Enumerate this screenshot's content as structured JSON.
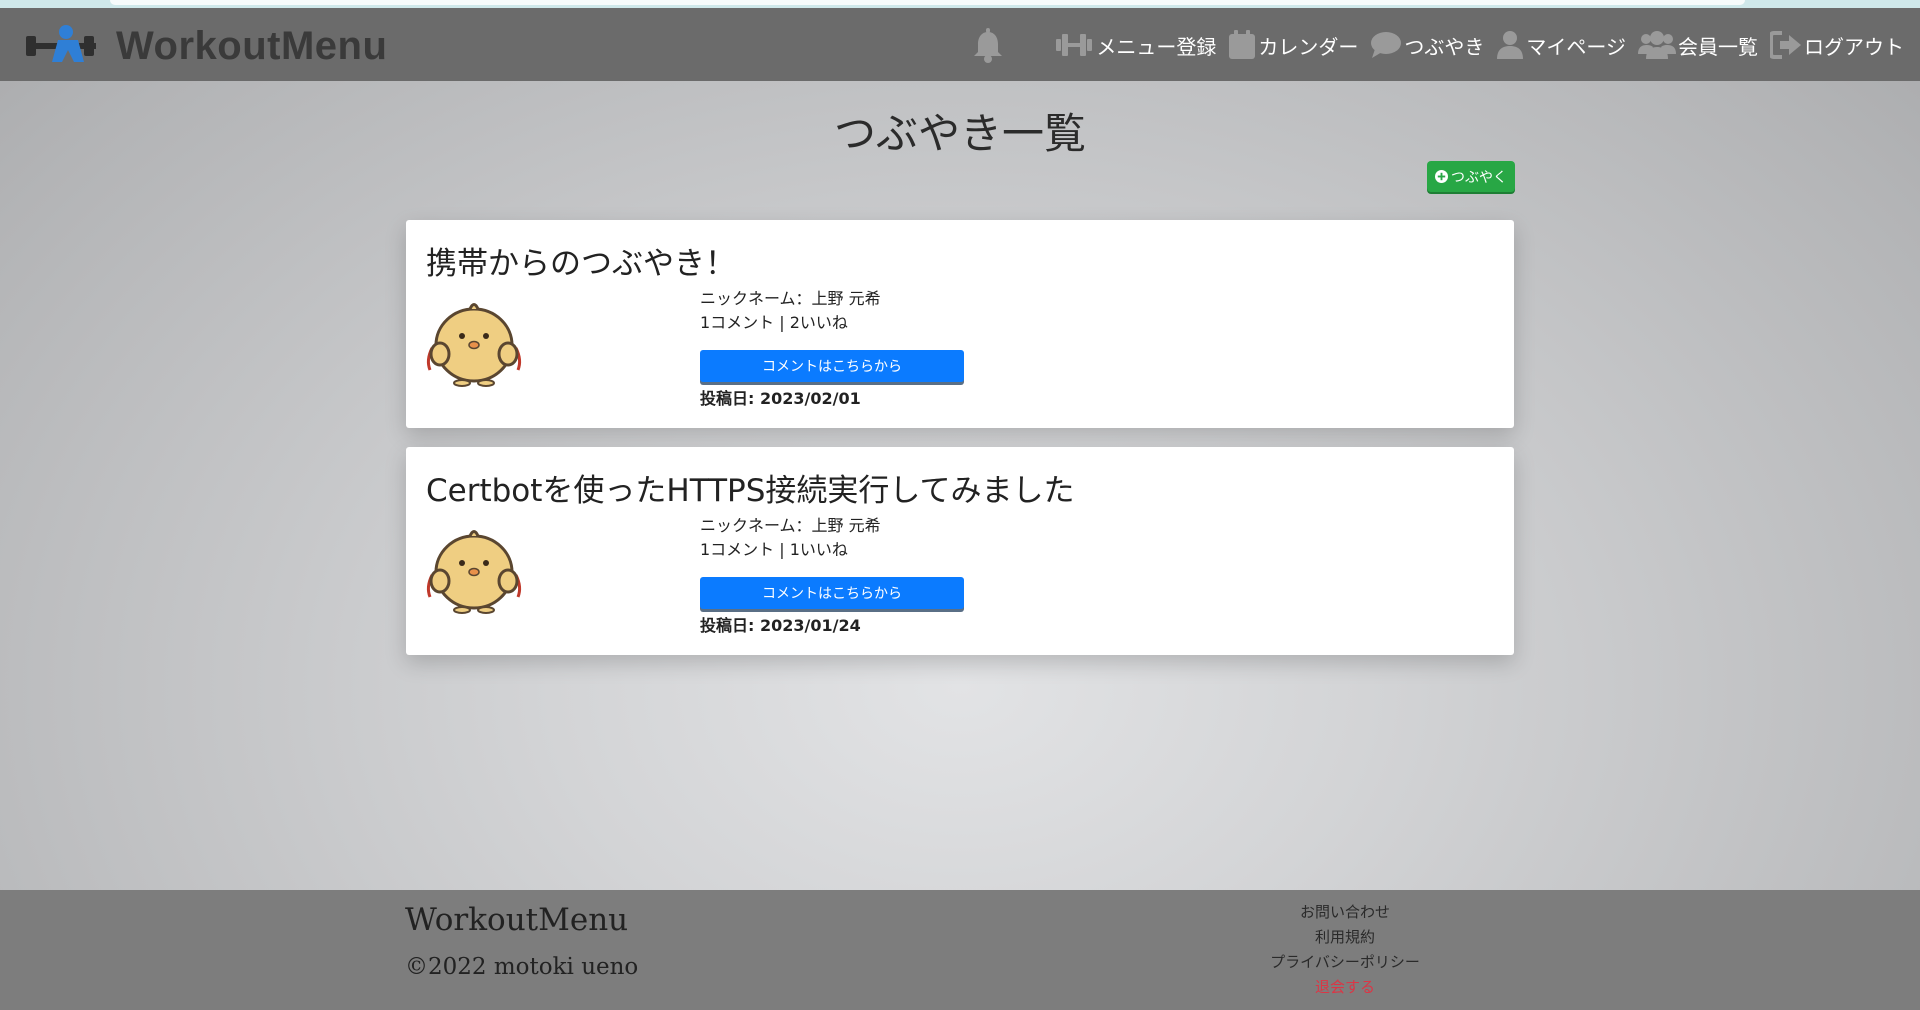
{
  "navbar": {
    "brand": "WorkoutMenu",
    "items": [
      {
        "label": "メニュー登録",
        "icon": "dumbbell-icon"
      },
      {
        "label": "カレンダー",
        "icon": "calendar-icon"
      },
      {
        "label": "つぶやき",
        "icon": "speech-bubble-icon"
      },
      {
        "label": "マイページ",
        "icon": "user-icon"
      },
      {
        "label": "会員一覧",
        "icon": "users-icon"
      },
      {
        "label": "ログアウト",
        "icon": "logout-icon"
      }
    ],
    "notification_icon": "bell-icon"
  },
  "page": {
    "title": "つぶやき一覧",
    "new_post_label": "つぶやく"
  },
  "posts": [
    {
      "title": "携帯からのつぶやき！",
      "nickname": "ニックネーム：上野 元希",
      "stats": "1コメント | 2いいね",
      "comment_button": "コメントはこちらから",
      "date": "投稿日: 2023/02/01"
    },
    {
      "title": "Certbotを使ったHTTPS接続実行してみました",
      "nickname": "ニックネーム：上野 元希",
      "stats": "1コメント | 1いいね",
      "comment_button": "コメントはこちらから",
      "date": "投稿日: 2023/01/24"
    }
  ],
  "footer": {
    "brand": "WorkoutMenu",
    "copyright": "©2022 motoki ueno",
    "links": [
      "お問い合わせ",
      "利用規約",
      "プライバシーポリシー",
      "退会する"
    ]
  },
  "colors": {
    "navbar": "#6b6b6b",
    "primary_button": "#0b7bff",
    "success_button": "#28a745",
    "danger_link": "#dc3545",
    "footer": "#7d7d7d"
  }
}
